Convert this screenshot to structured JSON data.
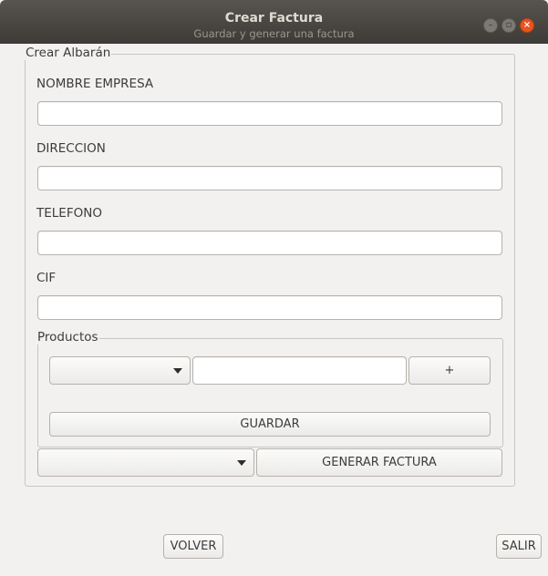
{
  "window": {
    "title": "Crear Factura",
    "subtitle": "Guardar y generar una factura",
    "controls": [
      "minimize-icon",
      "maximize-icon",
      "close-icon"
    ]
  },
  "form": {
    "group_title": "Crear Albarán",
    "fields": [
      {
        "label": "NOMBRE EMPRESA",
        "value": ""
      },
      {
        "label": "DIRECCION",
        "value": ""
      },
      {
        "label": "TELEFONO",
        "value": ""
      },
      {
        "label": "CIF",
        "value": ""
      }
    ],
    "products": {
      "group_title": "Productos",
      "combo_value": "",
      "quantity_value": "",
      "add_label": "+",
      "save_label": "GUARDAR"
    },
    "invoice_combo_value": "",
    "generate_label": "GENERAR FACTURA"
  },
  "footer": {
    "back_label": "VOLVER",
    "exit_label": "SALIR"
  },
  "colors": {
    "titlebar": "#3d3b37",
    "close": "#e95420",
    "background": "#f2f1f0"
  }
}
